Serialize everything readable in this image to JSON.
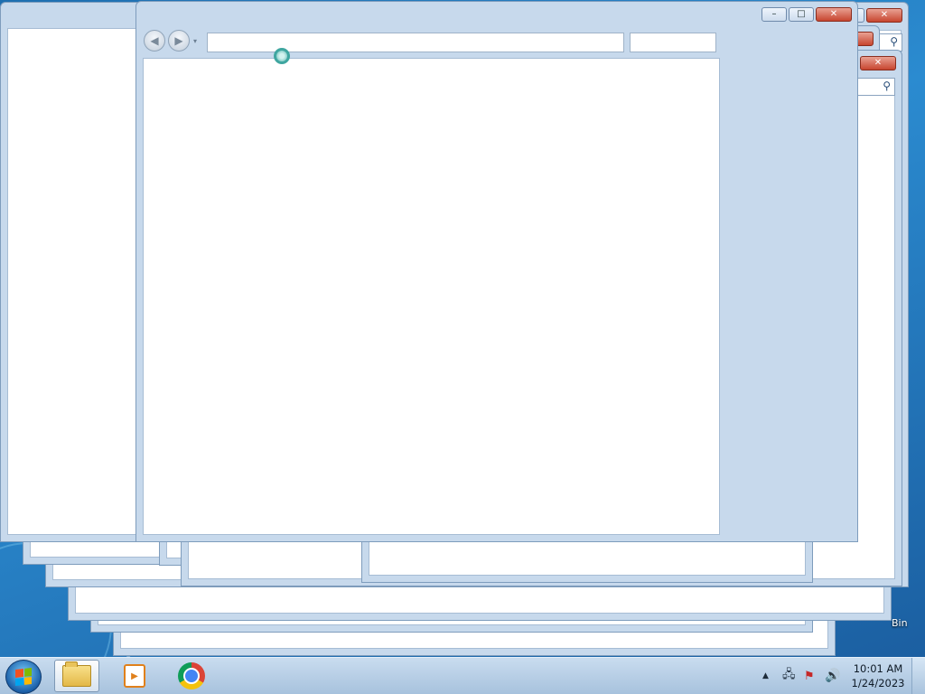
{
  "desktop": {
    "recycle_bin_label": "Bin"
  },
  "window_controls": {
    "minimize_glyph": "–",
    "maximize_glyph": "□",
    "close_glyph": "✕"
  },
  "search": {
    "icon": "search-icon",
    "glyph": "⚲"
  },
  "front_window": {
    "back_icon": "back-arrow-icon",
    "forward_icon": "forward-arrow-icon",
    "back_glyph": "◀",
    "forward_glyph": "▶",
    "history_dropdown_glyph": "▾",
    "address_value": "",
    "search_value": ""
  },
  "taskbar": {
    "start_icon": "windows-start-orb-icon",
    "pinned": [
      {
        "name": "windows-explorer",
        "icon": "folder-icon"
      },
      {
        "name": "media-player",
        "icon": "media-player-icon",
        "glyph": "▶"
      },
      {
        "name": "google-chrome",
        "icon": "chrome-icon"
      }
    ],
    "tray": {
      "show_hidden_glyph": "▲",
      "network_glyph": "🖧",
      "action_center_glyph": "⚑",
      "volume_glyph": "🔊"
    },
    "clock": {
      "time": "10:01 AM",
      "date": "1/24/2023"
    }
  },
  "colors": {
    "frame": "#c7d9ec",
    "close_button": "#c7452f",
    "taskbar": "#b8cfe6"
  }
}
